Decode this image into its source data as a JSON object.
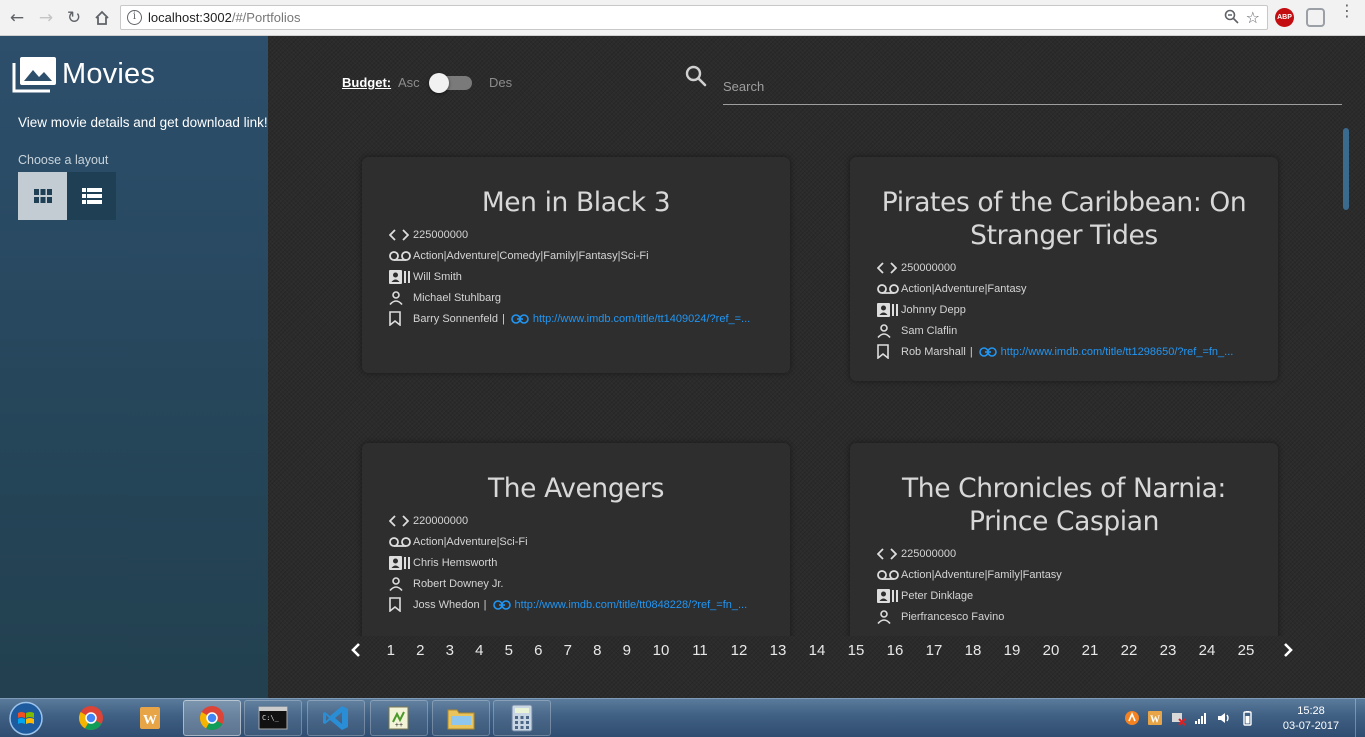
{
  "browser": {
    "url_host": "localhost:3002",
    "url_path": "/#/Portfolios",
    "extension_label": "ABP"
  },
  "sidebar": {
    "app_title": "Movies",
    "tagline": "View movie details and get download link!!",
    "layout_label": "Choose a layout",
    "layouts": [
      "grid-view",
      "list-view"
    ],
    "selected_layout": "grid-view"
  },
  "toolbar": {
    "budget_label": "Budget:",
    "asc_label": "Asc",
    "des_label": "Des",
    "sort_descending": false,
    "search_placeholder": "Search",
    "search_value": ""
  },
  "movies": [
    {
      "title": "Men in Black 3",
      "budget": "225000000",
      "genres": "Action|Adventure|Comedy|Family|Fantasy|Sci-Fi",
      "actor_1": "Will Smith",
      "actor_2": "Michael Stuhlbarg",
      "director": "Barry Sonnenfeld",
      "imdb_link": "http://www.imdb.com/title/tt1409024/?ref_=..."
    },
    {
      "title": "Pirates of the Caribbean: On Stranger Tides",
      "budget": "250000000",
      "genres": "Action|Adventure|Fantasy",
      "actor_1": "Johnny Depp",
      "actor_2": "Sam Claflin",
      "director": "Rob Marshall",
      "imdb_link": "http://www.imdb.com/title/tt1298650/?ref_=fn_..."
    },
    {
      "title": "The Avengers",
      "budget": "220000000",
      "genres": "Action|Adventure|Sci-Fi",
      "actor_1": "Chris Hemsworth",
      "actor_2": "Robert Downey Jr.",
      "director": "Joss Whedon",
      "imdb_link": "http://www.imdb.com/title/tt0848228/?ref_=fn_..."
    },
    {
      "title": "The Chronicles of Narnia: Prince Caspian",
      "budget": "225000000",
      "genres": "Action|Adventure|Family|Fantasy",
      "actor_1": "Peter Dinklage",
      "actor_2": "Pierfrancesco Favino",
      "director": "",
      "imdb_link": ""
    }
  ],
  "pagination": {
    "pages": [
      "1",
      "2",
      "3",
      "4",
      "5",
      "6",
      "7",
      "8",
      "9",
      "10",
      "11",
      "12",
      "13",
      "14",
      "15",
      "16",
      "17",
      "18",
      "19",
      "20",
      "21",
      "22",
      "23",
      "24",
      "25"
    ],
    "prev_icon": "chevron-left-icon",
    "next_icon": "chevron-right-icon"
  },
  "taskbar": {
    "items": [
      "chrome-icon",
      "word-icon",
      "chrome-active-icon",
      "cmd-icon",
      "vscode-icon",
      "notepadpp-icon",
      "explorer-icon",
      "calculator-icon"
    ],
    "clock_time": "15:28",
    "clock_date": "03-07-2017"
  },
  "colors": {
    "sidebar": "#2d4f6c",
    "main_bg": "#2b2b2b",
    "card_bg": "#2e2e2e",
    "link": "#2196f3",
    "accent_scroll": "#3b6a8f"
  }
}
